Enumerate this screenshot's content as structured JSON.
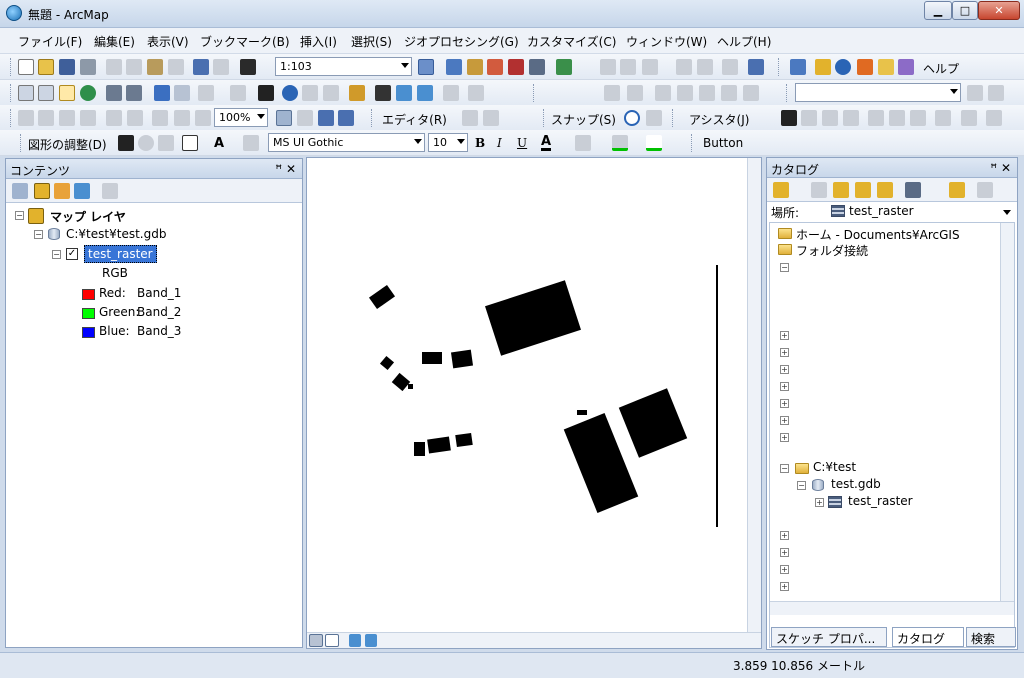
{
  "window": {
    "title": "無題 - ArcMap",
    "min_label": "▁",
    "max_label": "□",
    "close_label": "✕"
  },
  "menu": [
    "ファイル(F)",
    "編集(E)",
    "表示(V)",
    "ブックマーク(B)",
    "挿入(I)",
    "選択(S)",
    "ジオプロセシング(G)",
    "カスタマイズ(C)",
    "ウィンドウ(W)",
    "ヘルプ(H)"
  ],
  "toolbar1": {
    "scale": "1:103",
    "help_label": "ヘルプ"
  },
  "toolbar2": {
    "zoom": "100%",
    "editor_label": "エディタ(R)",
    "snap_label": "スナップ(S)",
    "assist_label": "アシスタ(J)"
  },
  "toolbar3": {
    "drawing_label": "図形の調整(D)",
    "text_tool": "A",
    "font": "MS UI Gothic",
    "font_size": "10",
    "bold": "B",
    "italic": "I",
    "underline": "U",
    "font_color": "A",
    "button_label": "Button"
  },
  "toc": {
    "title": "コンテンツ",
    "layers_label": "マップ レイヤ",
    "gdb_path": "C:¥test¥test.gdb",
    "raster_name": "test_raster",
    "rgb_label": "RGB",
    "bands": [
      {
        "label": "Red:",
        "band": "Band_1",
        "color": "#ff0000"
      },
      {
        "label": "Green:",
        "band": "Band_2",
        "color": "#00ff00"
      },
      {
        "label": "Blue:",
        "band": "Band_3",
        "color": "#0000ff"
      }
    ]
  },
  "catalog": {
    "title": "カタログ",
    "location_label": "場所:",
    "location_value": "test_raster",
    "home": "ホーム - Documents¥ArcGIS",
    "folder_connections": "フォルダ接続",
    "c_test": "C:¥test",
    "gdb": "test.gdb",
    "raster": "test_raster"
  },
  "tabs": {
    "sketch": "スケッチ プロパ...",
    "catalog": "カタログ",
    "search": "検索"
  },
  "status": {
    "coords": "3.859  10.856 メートル"
  },
  "panel_pin": "ꟸ ✕"
}
